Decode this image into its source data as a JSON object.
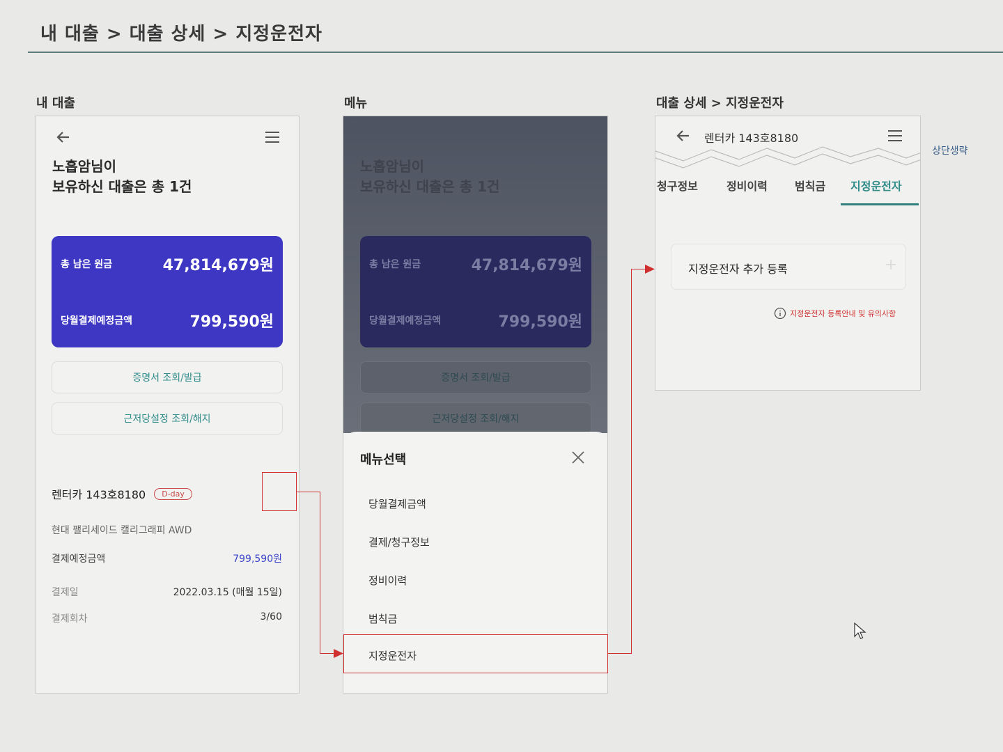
{
  "page_title": "내 대출 > 대출 상세 > 지정운전자",
  "sections": {
    "left": "내 대출",
    "middle": "메뉴",
    "right": "대출 상세 > 지정운전자"
  },
  "loan_screen": {
    "greeting_line1": "노흡암님이",
    "greeting_line2": "보유하신 대출은 총 1건",
    "card": {
      "remaining_label": "총 남은 원금",
      "remaining_value": "47,814,679원",
      "payment_label": "당월결제예정금액",
      "payment_value": "799,590원"
    },
    "btn_certificate": "증명서 조회/발급",
    "btn_mortgage": "근저당설정 조회/해지",
    "loan_item": {
      "name": "렌터카 143호8180",
      "badge": "D-day",
      "car": "현대 팰리세이드 캘리그래피 AWD",
      "rows": [
        {
          "label": "결제예정금액",
          "value": "799,590원"
        },
        {
          "label": "결제일",
          "value": "2022.03.15 (매월 15일)"
        },
        {
          "label": "결제회차",
          "value": "3/60"
        }
      ]
    }
  },
  "menu_sheet": {
    "title": "메뉴선택",
    "items": [
      "당월결제금액",
      "결제/청구정보",
      "정비이력",
      "범칙금",
      "지정운전자"
    ],
    "selected_index": 4
  },
  "detail_screen": {
    "header_title": "렌터카 143호8180",
    "omission_note": "상단생략",
    "tabs": [
      "청구정보",
      "정비이력",
      "범칙금",
      "지정운전자"
    ],
    "active_tab": 3,
    "add_label": "지정운전자 추가 등록",
    "info_text": "지정운전자 등록안내 및 유의사항"
  },
  "colors": {
    "card_bg": "#3d37c4",
    "teal": "#2f8c8a",
    "link_blue": "#3a44c9",
    "red": "#d03030"
  }
}
